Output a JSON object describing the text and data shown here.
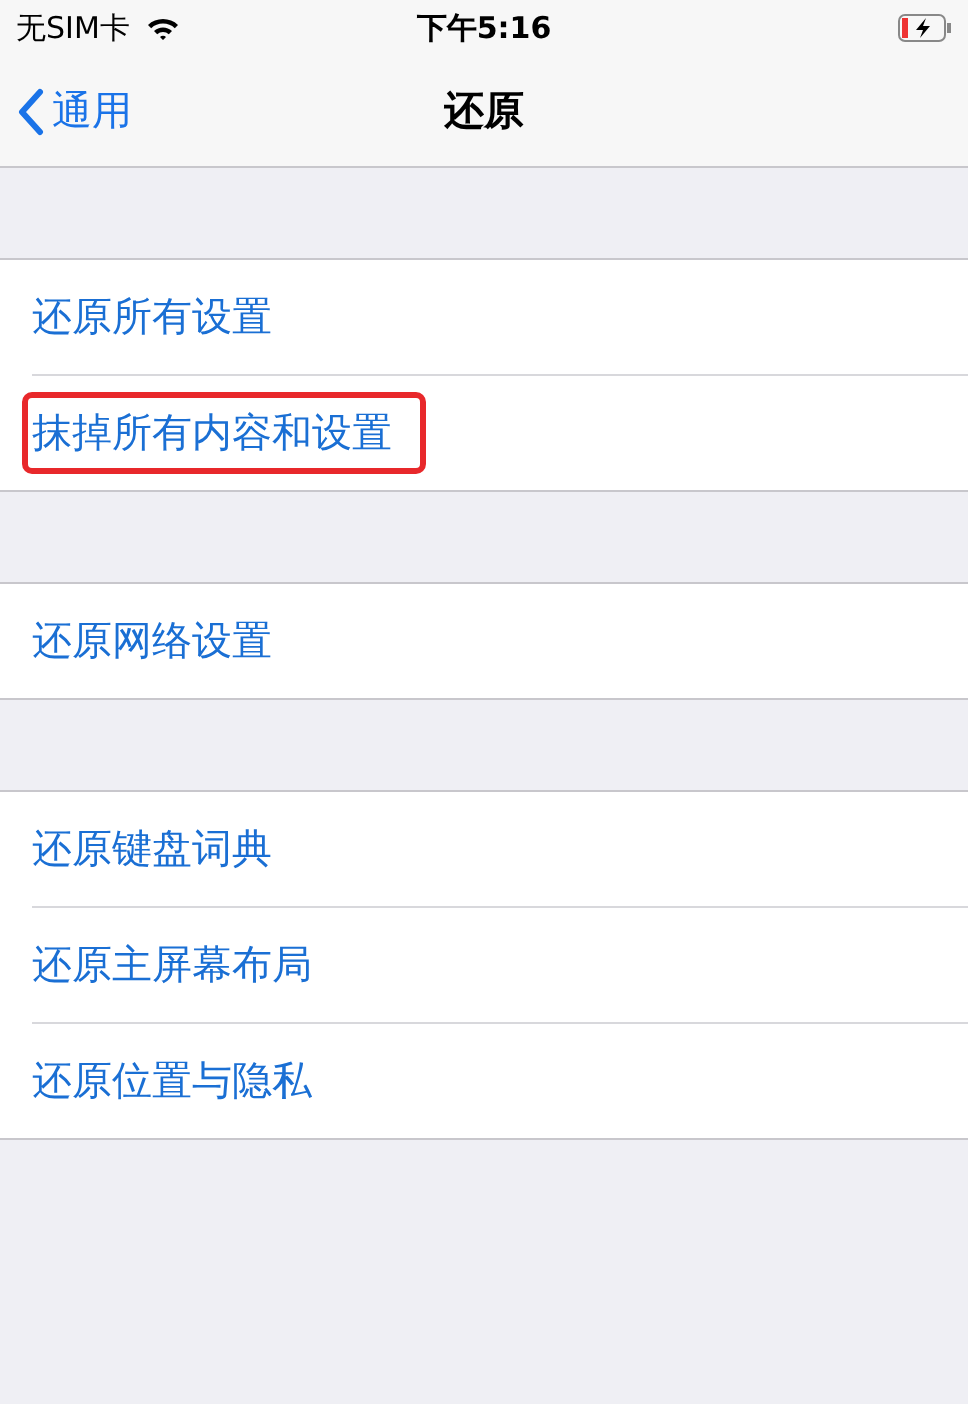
{
  "status_bar": {
    "carrier": "无SIM卡",
    "time": "下午5:16",
    "charging": true
  },
  "nav": {
    "back": "通用",
    "title": "还原"
  },
  "groups": [
    {
      "items": [
        {
          "label": "还原所有设置",
          "highlighted": false
        },
        {
          "label": "抹掉所有内容和设置",
          "highlighted": true
        }
      ]
    },
    {
      "items": [
        {
          "label": "还原网络设置",
          "highlighted": false
        }
      ]
    },
    {
      "items": [
        {
          "label": "还原键盘词典",
          "highlighted": false
        },
        {
          "label": "还原主屏幕布局",
          "highlighted": false
        },
        {
          "label": "还原位置与隐私",
          "highlighted": false
        }
      ]
    }
  ]
}
